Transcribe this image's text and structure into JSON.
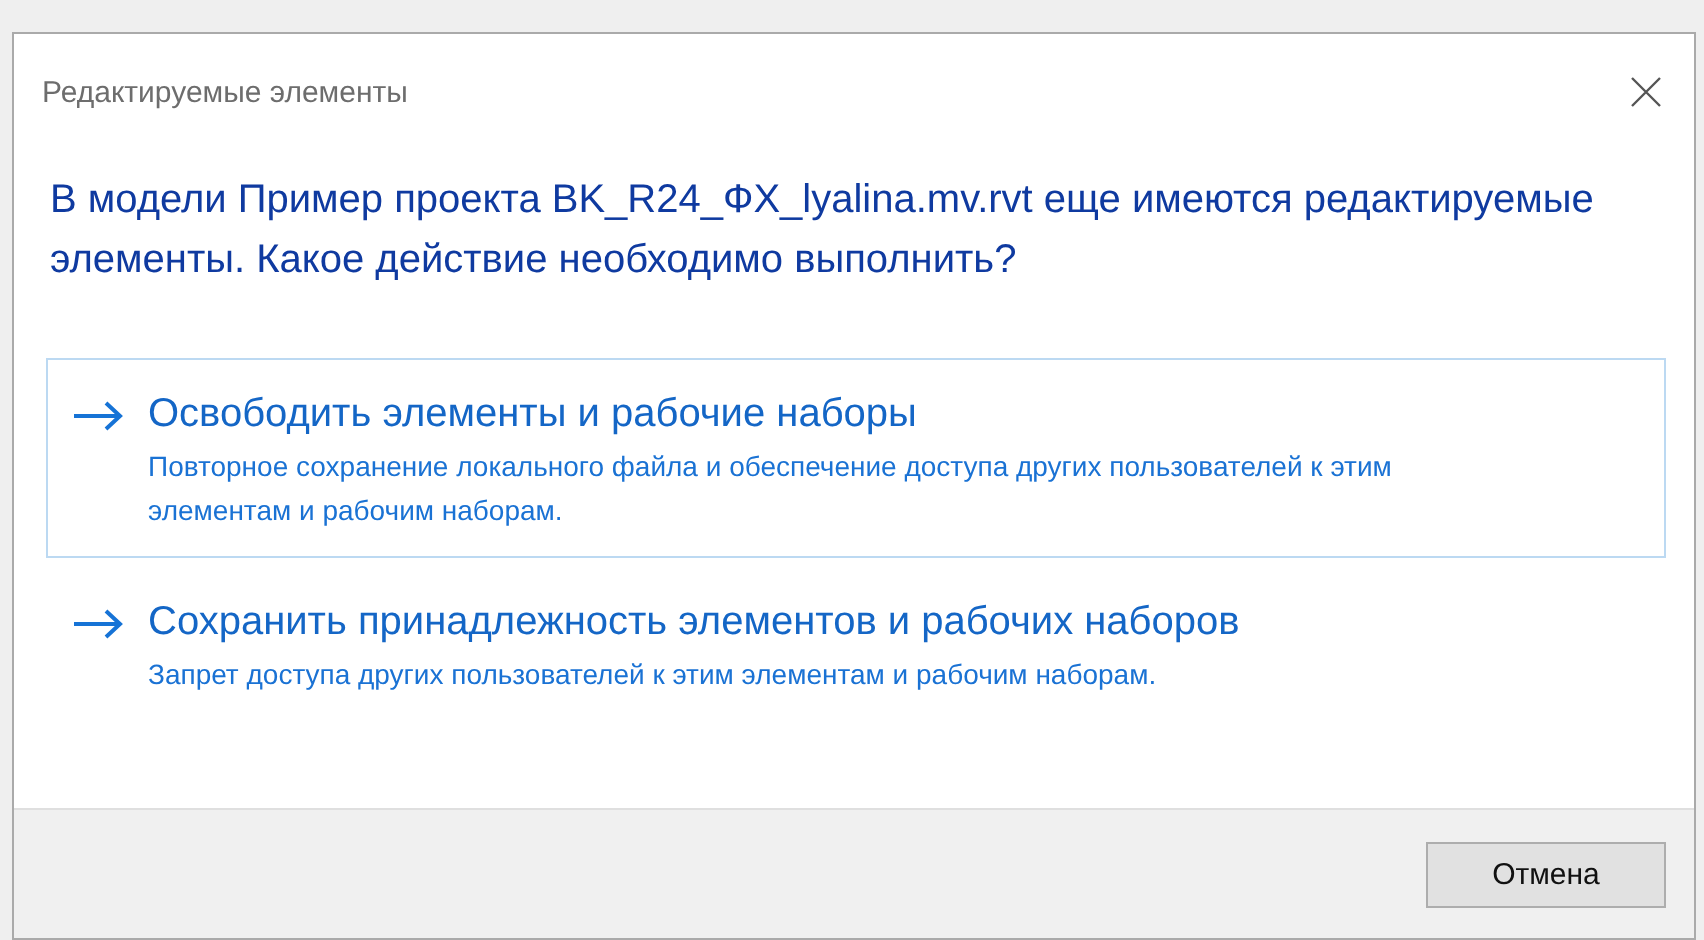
{
  "window": {
    "title": "Редактируемые элементы"
  },
  "message": "В модели Пример проекта BK_R24_ФХ_lyalina.mv.rvt еще имеются редактируемые элементы. Какое действие необходимо выполнить?",
  "options": [
    {
      "title": "Освободить элементы и рабочие наборы",
      "description": "Повторное сохранение локального файла и обеспечение доступа других пользователей к этим элементам и рабочим наборам.",
      "selected": true
    },
    {
      "title": "Сохранить принадлежность элементов и рабочих наборов",
      "description": "Запрет доступа других пользователей к этим элементам и рабочим наборам.",
      "selected": false
    }
  ],
  "buttons": [
    "Отмена"
  ]
}
